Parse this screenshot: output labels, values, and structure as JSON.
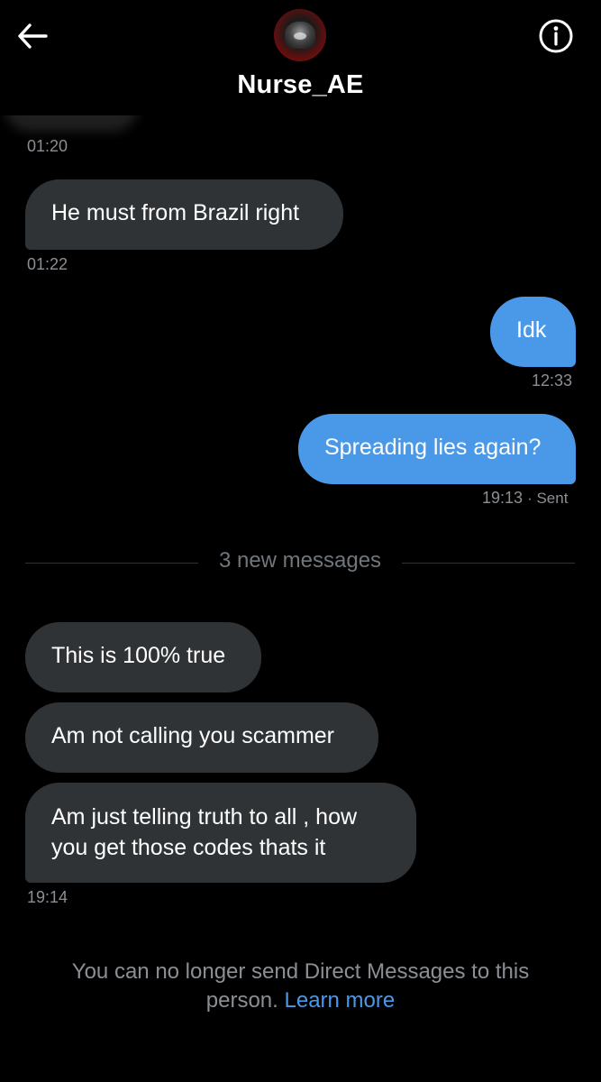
{
  "header": {
    "contact_name": "Nurse_AE",
    "back_icon": "arrow-left-icon",
    "info_icon": "info-circle-icon"
  },
  "messages": [
    {
      "direction": "received",
      "time": "01:20"
    },
    {
      "direction": "received",
      "text": "He must from Brazil right",
      "time": "01:22"
    },
    {
      "direction": "sent",
      "text": "Idk",
      "time": "12:33"
    },
    {
      "direction": "sent",
      "text": "Spreading lies again?",
      "time": "19:13",
      "status": "· Sent"
    },
    {
      "direction": "received",
      "text": "This is 100% true"
    },
    {
      "direction": "received",
      "text": "Am not calling you scammer"
    },
    {
      "direction": "received",
      "text_line1": "Am just telling truth to all , how",
      "text_line2": "you get those codes thats it",
      "time": "19:14"
    }
  ],
  "divider": {
    "label": "3 new messages"
  },
  "footer": {
    "notice": "You can no longer send Direct Messages to this person.",
    "link": "Learn more"
  },
  "colors": {
    "background": "#000000",
    "received_bubble": "#2f3336",
    "sent_bubble": "#4a99e9",
    "link": "#4a99e9",
    "muted_text": "#8b8f94"
  }
}
